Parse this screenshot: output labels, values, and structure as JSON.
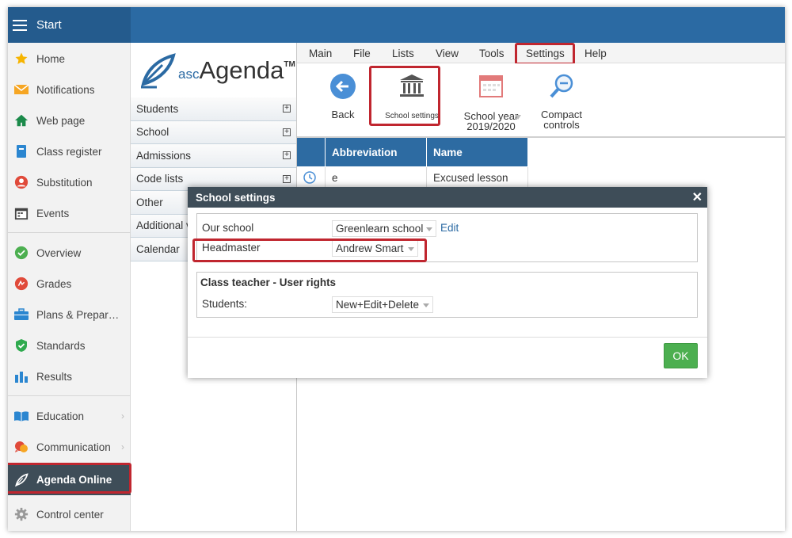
{
  "topbar": {
    "start_label": "Start"
  },
  "sidebar": {
    "items": [
      {
        "label": "Home",
        "icon": "star-icon"
      },
      {
        "label": "Notifications",
        "icon": "envelope-icon"
      },
      {
        "label": "Web page",
        "icon": "house-icon"
      },
      {
        "label": "Class register",
        "icon": "register-icon"
      },
      {
        "label": "Substitution",
        "icon": "person-icon"
      },
      {
        "label": "Events",
        "icon": "calendar-icon"
      },
      {
        "label": "Overview",
        "icon": "check-circle-icon"
      },
      {
        "label": "Grades",
        "icon": "grades-icon"
      },
      {
        "label": "Plans & Prepar…",
        "icon": "briefcase-icon"
      },
      {
        "label": "Standards",
        "icon": "shield-check-icon"
      },
      {
        "label": "Results",
        "icon": "bar-chart-icon"
      },
      {
        "label": "Education",
        "icon": "book-icon"
      },
      {
        "label": "Communication",
        "icon": "chat-icon"
      },
      {
        "label": "Agenda Online",
        "icon": "feather-icon"
      },
      {
        "label": "Control center",
        "icon": "gear-icon"
      }
    ]
  },
  "logo": {
    "prefix": "asc",
    "name": "Agenda",
    "tm": "TM"
  },
  "tree": {
    "items": [
      "Students",
      "School",
      "Admissions",
      "Code lists",
      "Other",
      "Additional v",
      "Calendar"
    ]
  },
  "menu": {
    "items": [
      "Main",
      "File",
      "Lists",
      "View",
      "Tools",
      "Settings",
      "Help"
    ]
  },
  "ribbon": {
    "back": "Back",
    "school_settings": "School settings",
    "school_year_line1": "School year",
    "school_year_line2": "2019/2020",
    "compact_line1": "Compact",
    "compact_line2": "controls"
  },
  "table": {
    "headers": [
      "Abbreviation",
      "Name"
    ],
    "row": {
      "abbreviation": "e",
      "name": "Excused lesson"
    }
  },
  "dialog": {
    "title": "School settings",
    "our_school_label": "Our school",
    "our_school_value": "Greenlearn school",
    "edit_link": "Edit",
    "headmaster_label": "Headmaster",
    "headmaster_value": "Andrew Smart",
    "group_title": "Class teacher - User rights",
    "students_label": "Students:",
    "students_value": "New+Edit+Delete",
    "ok": "OK"
  },
  "colors": {
    "topbar": "#2b6aa3",
    "highlight": "#c0262f",
    "ok_button": "#4caf50",
    "dialog_header": "#3e4d58"
  }
}
